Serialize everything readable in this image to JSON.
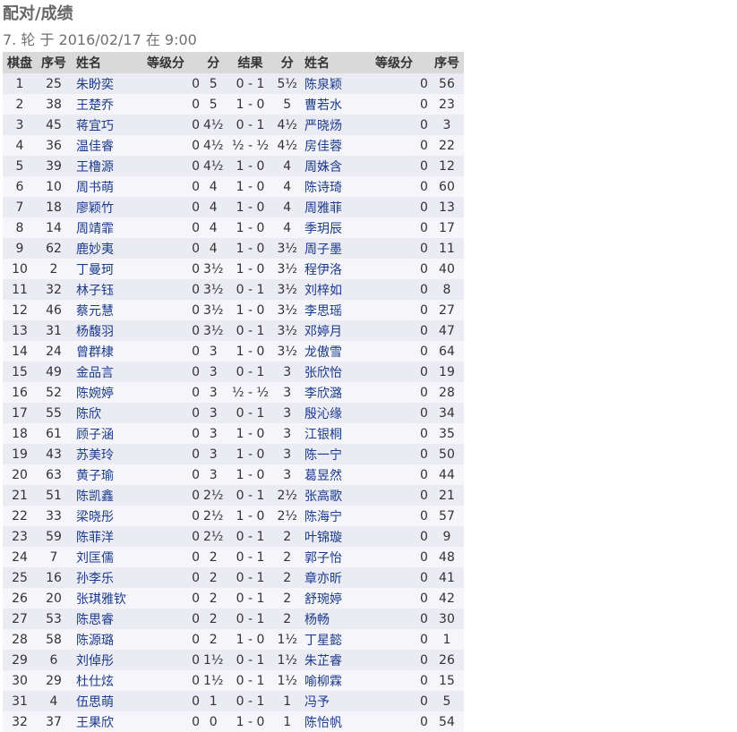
{
  "title": "配对/成绩",
  "round_info": "7. 轮 于 2016/02/17 在 9:00",
  "columns": [
    "棋盘",
    "序号",
    "姓名",
    "等级分",
    "分",
    "结果",
    "分",
    "姓名",
    "等级分",
    "序号"
  ],
  "rows": [
    {
      "board": "1",
      "w_seq": "25",
      "w_name": "朱盼奕",
      "w_rating": "0",
      "w_pts": "5",
      "result": "0 - 1",
      "b_pts": "5½",
      "b_name": "陈泉颖",
      "b_rating": "0",
      "b_seq": "56"
    },
    {
      "board": "2",
      "w_seq": "38",
      "w_name": "王楚乔",
      "w_rating": "0",
      "w_pts": "5",
      "result": "1 - 0",
      "b_pts": "5",
      "b_name": "曹若水",
      "b_rating": "0",
      "b_seq": "23"
    },
    {
      "board": "3",
      "w_seq": "45",
      "w_name": "蒋宜巧",
      "w_rating": "0",
      "w_pts": "4½",
      "result": "0 - 1",
      "b_pts": "4½",
      "b_name": "严晓炀",
      "b_rating": "0",
      "b_seq": "3"
    },
    {
      "board": "4",
      "w_seq": "36",
      "w_name": "温佳睿",
      "w_rating": "0",
      "w_pts": "4½",
      "result": "½ - ½",
      "b_pts": "4½",
      "b_name": "房佳蓉",
      "b_rating": "0",
      "b_seq": "22"
    },
    {
      "board": "5",
      "w_seq": "39",
      "w_name": "王橹源",
      "w_rating": "0",
      "w_pts": "4½",
      "result": "1 - 0",
      "b_pts": "4",
      "b_name": "周姝含",
      "b_rating": "0",
      "b_seq": "12"
    },
    {
      "board": "6",
      "w_seq": "10",
      "w_name": "周书萌",
      "w_rating": "0",
      "w_pts": "4",
      "result": "1 - 0",
      "b_pts": "4",
      "b_name": "陈诗琦",
      "b_rating": "0",
      "b_seq": "60"
    },
    {
      "board": "7",
      "w_seq": "18",
      "w_name": "廖颖竹",
      "w_rating": "0",
      "w_pts": "4",
      "result": "1 - 0",
      "b_pts": "4",
      "b_name": "周雅菲",
      "b_rating": "0",
      "b_seq": "13"
    },
    {
      "board": "8",
      "w_seq": "14",
      "w_name": "周靖霏",
      "w_rating": "0",
      "w_pts": "4",
      "result": "1 - 0",
      "b_pts": "4",
      "b_name": "季玥辰",
      "b_rating": "0",
      "b_seq": "17"
    },
    {
      "board": "9",
      "w_seq": "62",
      "w_name": "鹿妙夷",
      "w_rating": "0",
      "w_pts": "4",
      "result": "1 - 0",
      "b_pts": "3½",
      "b_name": "周子墨",
      "b_rating": "0",
      "b_seq": "11"
    },
    {
      "board": "10",
      "w_seq": "2",
      "w_name": "丁曼珂",
      "w_rating": "0",
      "w_pts": "3½",
      "result": "1 - 0",
      "b_pts": "3½",
      "b_name": "程伊洛",
      "b_rating": "0",
      "b_seq": "40"
    },
    {
      "board": "11",
      "w_seq": "32",
      "w_name": "林子钰",
      "w_rating": "0",
      "w_pts": "3½",
      "result": "0 - 1",
      "b_pts": "3½",
      "b_name": "刘梓如",
      "b_rating": "0",
      "b_seq": "8"
    },
    {
      "board": "12",
      "w_seq": "46",
      "w_name": "蔡元慧",
      "w_rating": "0",
      "w_pts": "3½",
      "result": "1 - 0",
      "b_pts": "3½",
      "b_name": "李思瑶",
      "b_rating": "0",
      "b_seq": "27"
    },
    {
      "board": "13",
      "w_seq": "31",
      "w_name": "杨馥羽",
      "w_rating": "0",
      "w_pts": "3½",
      "result": "0 - 1",
      "b_pts": "3½",
      "b_name": "邓婷月",
      "b_rating": "0",
      "b_seq": "47"
    },
    {
      "board": "14",
      "w_seq": "24",
      "w_name": "曾群棣",
      "w_rating": "0",
      "w_pts": "3",
      "result": "1 - 0",
      "b_pts": "3½",
      "b_name": "龙傲雪",
      "b_rating": "0",
      "b_seq": "64"
    },
    {
      "board": "15",
      "w_seq": "49",
      "w_name": "金品言",
      "w_rating": "0",
      "w_pts": "3",
      "result": "0 - 1",
      "b_pts": "3",
      "b_name": "张欣怡",
      "b_rating": "0",
      "b_seq": "19"
    },
    {
      "board": "16",
      "w_seq": "52",
      "w_name": "陈婉婷",
      "w_rating": "0",
      "w_pts": "3",
      "result": "½ - ½",
      "b_pts": "3",
      "b_name": "李欣潞",
      "b_rating": "0",
      "b_seq": "28"
    },
    {
      "board": "17",
      "w_seq": "55",
      "w_name": "陈欣",
      "w_rating": "0",
      "w_pts": "3",
      "result": "0 - 1",
      "b_pts": "3",
      "b_name": "殷沁缘",
      "b_rating": "0",
      "b_seq": "34"
    },
    {
      "board": "18",
      "w_seq": "61",
      "w_name": "顾子涵",
      "w_rating": "0",
      "w_pts": "3",
      "result": "1 - 0",
      "b_pts": "3",
      "b_name": "江银桐",
      "b_rating": "0",
      "b_seq": "35"
    },
    {
      "board": "19",
      "w_seq": "43",
      "w_name": "苏美玲",
      "w_rating": "0",
      "w_pts": "3",
      "result": "1 - 0",
      "b_pts": "3",
      "b_name": "陈一宁",
      "b_rating": "0",
      "b_seq": "50"
    },
    {
      "board": "20",
      "w_seq": "63",
      "w_name": "黄子瑜",
      "w_rating": "0",
      "w_pts": "3",
      "result": "1 - 0",
      "b_pts": "3",
      "b_name": "葛昱然",
      "b_rating": "0",
      "b_seq": "44"
    },
    {
      "board": "21",
      "w_seq": "51",
      "w_name": "陈凯鑫",
      "w_rating": "0",
      "w_pts": "2½",
      "result": "0 - 1",
      "b_pts": "2½",
      "b_name": "张高歌",
      "b_rating": "0",
      "b_seq": "21"
    },
    {
      "board": "22",
      "w_seq": "33",
      "w_name": "梁晓彤",
      "w_rating": "0",
      "w_pts": "2½",
      "result": "1 - 0",
      "b_pts": "2½",
      "b_name": "陈海宁",
      "b_rating": "0",
      "b_seq": "57"
    },
    {
      "board": "23",
      "w_seq": "59",
      "w_name": "陈菲洋",
      "w_rating": "0",
      "w_pts": "2½",
      "result": "0 - 1",
      "b_pts": "2",
      "b_name": "叶锦璇",
      "b_rating": "0",
      "b_seq": "9"
    },
    {
      "board": "24",
      "w_seq": "7",
      "w_name": "刘匡儒",
      "w_rating": "0",
      "w_pts": "2",
      "result": "0 - 1",
      "b_pts": "2",
      "b_name": "郭子怡",
      "b_rating": "0",
      "b_seq": "48"
    },
    {
      "board": "25",
      "w_seq": "16",
      "w_name": "孙李乐",
      "w_rating": "0",
      "w_pts": "2",
      "result": "0 - 1",
      "b_pts": "2",
      "b_name": "章亦昕",
      "b_rating": "0",
      "b_seq": "41"
    },
    {
      "board": "26",
      "w_seq": "20",
      "w_name": "张琪雅钦",
      "w_rating": "0",
      "w_pts": "2",
      "result": "0 - 1",
      "b_pts": "2",
      "b_name": "舒琬婷",
      "b_rating": "0",
      "b_seq": "42"
    },
    {
      "board": "27",
      "w_seq": "53",
      "w_name": "陈思睿",
      "w_rating": "0",
      "w_pts": "2",
      "result": "0 - 1",
      "b_pts": "2",
      "b_name": "杨畅",
      "b_rating": "0",
      "b_seq": "30"
    },
    {
      "board": "28",
      "w_seq": "58",
      "w_name": "陈源璐",
      "w_rating": "0",
      "w_pts": "2",
      "result": "1 - 0",
      "b_pts": "1½",
      "b_name": "丁星懿",
      "b_rating": "0",
      "b_seq": "1"
    },
    {
      "board": "29",
      "w_seq": "6",
      "w_name": "刘倬彤",
      "w_rating": "0",
      "w_pts": "1½",
      "result": "0 - 1",
      "b_pts": "1½",
      "b_name": "朱芷睿",
      "b_rating": "0",
      "b_seq": "26"
    },
    {
      "board": "30",
      "w_seq": "29",
      "w_name": "杜仕炫",
      "w_rating": "0",
      "w_pts": "1½",
      "result": "0 - 1",
      "b_pts": "1½",
      "b_name": "喻柳霖",
      "b_rating": "0",
      "b_seq": "15"
    },
    {
      "board": "31",
      "w_seq": "4",
      "w_name": "伍思萌",
      "w_rating": "0",
      "w_pts": "1",
      "result": "0 - 1",
      "b_pts": "1",
      "b_name": "冯予",
      "b_rating": "0",
      "b_seq": "5"
    },
    {
      "board": "32",
      "w_seq": "37",
      "w_name": "王果欣",
      "w_rating": "0",
      "w_pts": "0",
      "result": "1 - 0",
      "b_pts": "1",
      "b_name": "陈怡帆",
      "b_rating": "0",
      "b_seq": "54"
    }
  ]
}
